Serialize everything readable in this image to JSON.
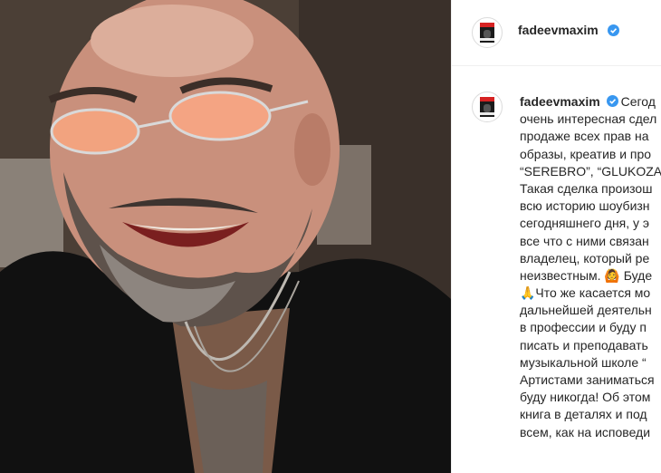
{
  "post": {
    "username": "fadeevmaxim",
    "verified": true,
    "caption_lines": [
      "Сегод",
      "очень интересная сдел",
      "продаже всех прав на",
      "образы, креатив и про",
      "“SEREBRO”, “GLUKOZA",
      "Такая сделка произош",
      "всю историю шоубизн",
      "сегодняшнего дня, у э",
      "все что с ними связан",
      "владелец, который ре",
      "неизвестным. 🙆 Буде",
      "🙏Что же касается мо",
      "дальнейшей деятельн",
      "в профессии и буду п",
      "писать и преподавать",
      "музыкальной школе “",
      "Артистами заниматься",
      "буду никогда! Об этом",
      "книга в деталях и под",
      "всем, как на исповеди"
    ]
  },
  "icons": {
    "verified_badge": "verified-icon",
    "avatar": "album-cover-avatar"
  },
  "colors": {
    "verified": "#3897f0",
    "text": "#262626",
    "divider": "#efefef"
  }
}
